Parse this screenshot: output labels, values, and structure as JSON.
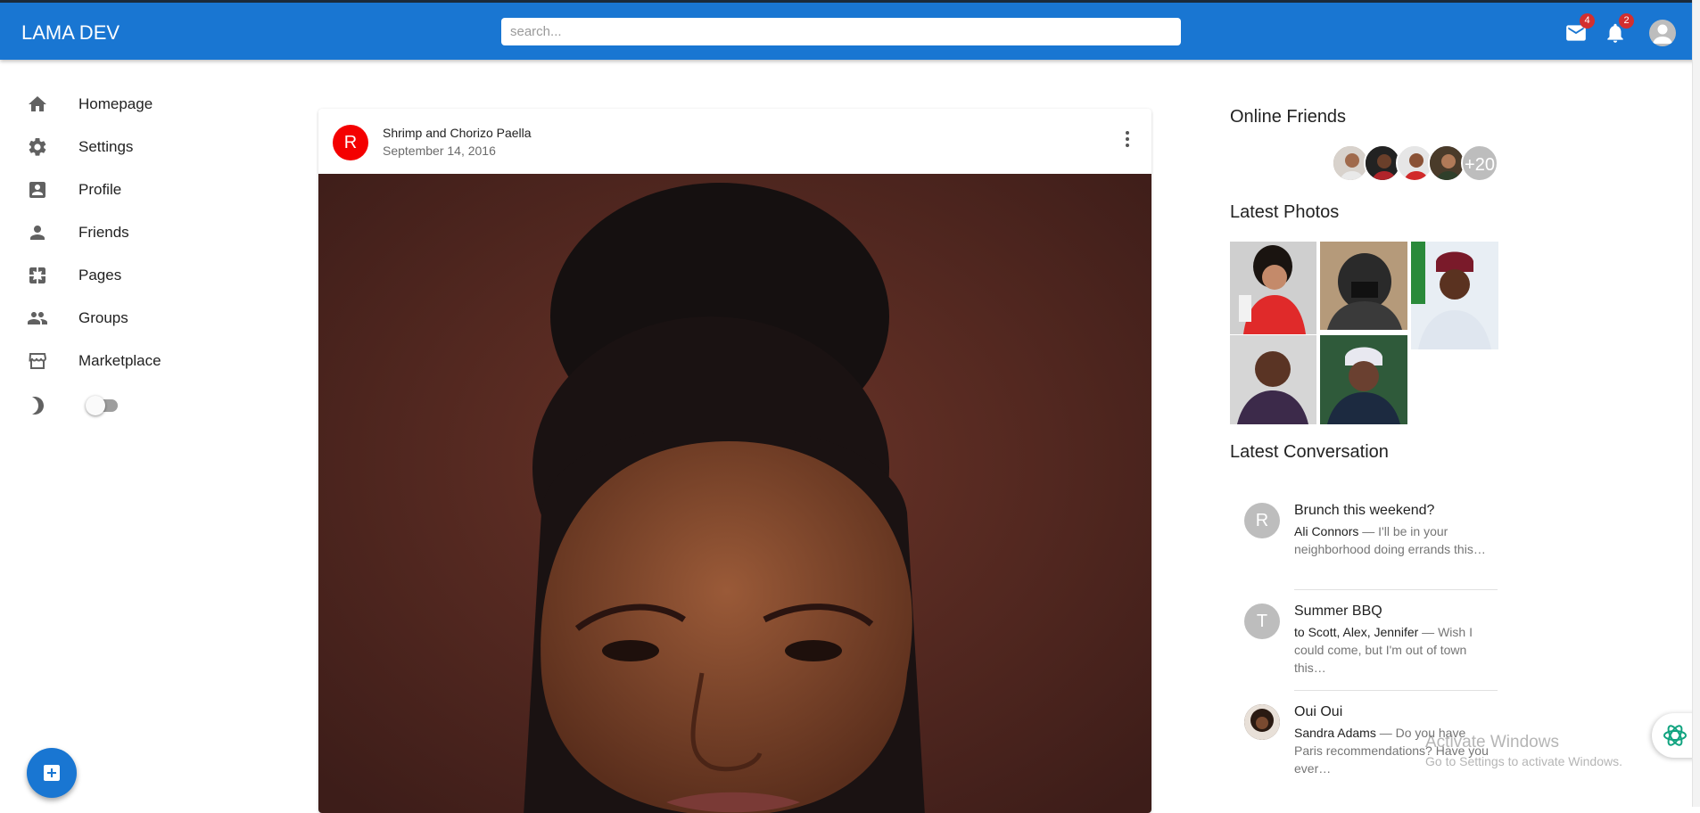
{
  "app": {
    "title": "LAMA DEV"
  },
  "search": {
    "placeholder": "search..."
  },
  "header": {
    "mail_count": "4",
    "notif_count": "2"
  },
  "sidebar": {
    "items": [
      {
        "label": "Homepage",
        "icon": "home-icon"
      },
      {
        "label": "Settings",
        "icon": "gear-icon"
      },
      {
        "label": "Profile",
        "icon": "account-box-icon"
      },
      {
        "label": "Friends",
        "icon": "person-icon"
      },
      {
        "label": "Pages",
        "icon": "pages-icon"
      },
      {
        "label": "Groups",
        "icon": "group-icon"
      },
      {
        "label": "Marketplace",
        "icon": "storefront-icon"
      }
    ],
    "dark_mode_on": false
  },
  "post": {
    "avatar_letter": "R",
    "title": "Shrimp and Chorizo Paella",
    "date": "September 14, 2016"
  },
  "right": {
    "online_friends_title": "Online Friends",
    "online_more": "+20",
    "latest_photos_title": "Latest Photos",
    "latest_conversation_title": "Latest Conversation",
    "conversations": [
      {
        "avatar": "R",
        "title": "Brunch this weekend?",
        "who": "Ali Connors",
        "text": " — I'll be in your neighborhood doing errands this…"
      },
      {
        "avatar": "T",
        "title": "Summer BBQ",
        "who": "to Scott, Alex, Jennifer",
        "text": " — Wish I could come, but I'm out of town this…"
      },
      {
        "avatar": "",
        "title": "Oui Oui",
        "who": "Sandra Adams",
        "text": " — Do you have Paris recommendations? Have you ever…"
      }
    ]
  },
  "os": {
    "watermark_title": "Activate Windows",
    "watermark_sub": "Go to Settings to activate Windows."
  },
  "colors": {
    "primary": "#1976d2",
    "badge": "#d32f2f",
    "post_avatar": "#f40000"
  }
}
